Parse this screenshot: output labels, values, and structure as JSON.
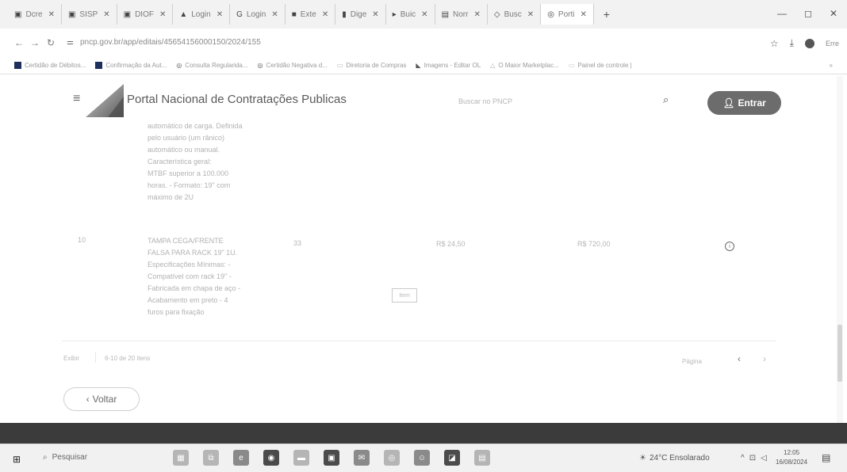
{
  "browser": {
    "tabs": [
      {
        "label": "Dcre",
        "icon": "document-icon"
      },
      {
        "label": "SISP",
        "icon": "document-icon"
      },
      {
        "label": "DIOF",
        "icon": "document-icon"
      },
      {
        "label": "Login",
        "icon": "document-icon"
      },
      {
        "label": "Login",
        "icon": "google-icon"
      },
      {
        "label": "Exte",
        "icon": "document-icon"
      },
      {
        "label": "Dige",
        "icon": "document-icon"
      },
      {
        "label": "Buic",
        "icon": "document-icon"
      },
      {
        "label": "Norr",
        "icon": "document-icon"
      },
      {
        "label": "Busc",
        "icon": "document-icon"
      },
      {
        "label": "Porti",
        "icon": "globe-icon"
      }
    ],
    "url": "pncp.gov.br/app/editais/45654156000150/2024/155",
    "profile_label": "Erre",
    "bookmarks": [
      "Certidão de Débitos...",
      "Confirmação da Aut...",
      "Consulta Regularida...",
      "Certidão Negativa d...",
      "Diretoria de Compras",
      "Imagens - Editar OL",
      "O Maior Marketplac...",
      "Painel de controle |"
    ]
  },
  "site": {
    "title": "Portal Nacional de Contratações Publicas",
    "search_placeholder": "Buscar no PNCP",
    "login_label": "Entrar"
  },
  "items": {
    "prev_desc_lines": [
      "automático de carga. Definida",
      "pelo usuário (um rânico)",
      "automático ou manual.",
      "Característica geral:",
      "MTBF superior a 100.000",
      "horas. - Formato: 19\" com",
      "máximo de 2U"
    ],
    "row": {
      "number": "10",
      "desc_lines": [
        "TAMPA CEGA/FRENTE",
        "FALSA PARA RACK 19\" 1U.",
        "Especificações Mínimas: -",
        "Compatível com rack 19\" -",
        "Fabricada em chapa de aço -",
        "Acabamento em preto - 4",
        "furos para fixação"
      ],
      "quantity": "33",
      "unit_value": "R$ 24,50",
      "total_value": "R$ 720,00",
      "badge": "Item"
    }
  },
  "pagination": {
    "page_size_label": "Exibir",
    "range_label": "6-10 de 20 itens",
    "page_label": "Página"
  },
  "back_label": "Voltar",
  "taskbar": {
    "search_placeholder": "Pesquisar",
    "weather": "24°C Ensolarado",
    "time": "12:05",
    "date": "16/08/2024"
  }
}
